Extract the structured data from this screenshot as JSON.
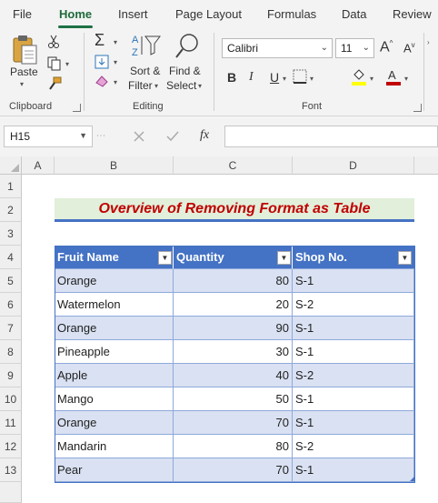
{
  "menu": {
    "tabs": [
      "File",
      "Home",
      "Insert",
      "Page Layout",
      "Formulas",
      "Data",
      "Review"
    ],
    "active": "Home"
  },
  "ribbon": {
    "clipboard": {
      "paste_label": "Paste",
      "group_label": "Clipboard"
    },
    "editing": {
      "sort_label_1": "Sort &",
      "sort_label_2": "Filter",
      "find_label_1": "Find &",
      "find_label_2": "Select",
      "group_label": "Editing"
    },
    "font": {
      "font_name": "Calibri",
      "font_size": "11",
      "group_label": "Font",
      "grow_label": "A",
      "shrink_label": "A",
      "bold": "B",
      "italic": "I",
      "underline": "U",
      "fill_color": "#ffff00",
      "font_color": "#c00000"
    }
  },
  "formula_bar": {
    "name_box": "H15",
    "fx": "fx",
    "formula": ""
  },
  "columns": [
    "A",
    "B",
    "C",
    "D"
  ],
  "rows": [
    "1",
    "2",
    "3",
    "4",
    "5",
    "6",
    "7",
    "8",
    "9",
    "10",
    "11",
    "12",
    "13"
  ],
  "sheet": {
    "title": "Overview of Removing Format as Table",
    "headers": [
      "Fruit Name",
      "Quantity",
      "Shop No."
    ],
    "data": [
      [
        "Orange",
        "80",
        "S-1"
      ],
      [
        "Watermelon",
        "20",
        "S-2"
      ],
      [
        "Orange",
        "90",
        "S-1"
      ],
      [
        "Pineapple",
        "30",
        "S-1"
      ],
      [
        "Apple",
        "40",
        "S-2"
      ],
      [
        "Mango",
        "50",
        "S-1"
      ],
      [
        "Orange",
        "70",
        "S-1"
      ],
      [
        "Mandarin",
        "80",
        "S-2"
      ],
      [
        "Pear",
        "70",
        "S-1"
      ]
    ]
  },
  "colors": {
    "accent": "#1e7145",
    "table_header": "#4472c4",
    "band": "#d9e1f2",
    "title_fill": "#e2efda",
    "title_text": "#c00000"
  }
}
